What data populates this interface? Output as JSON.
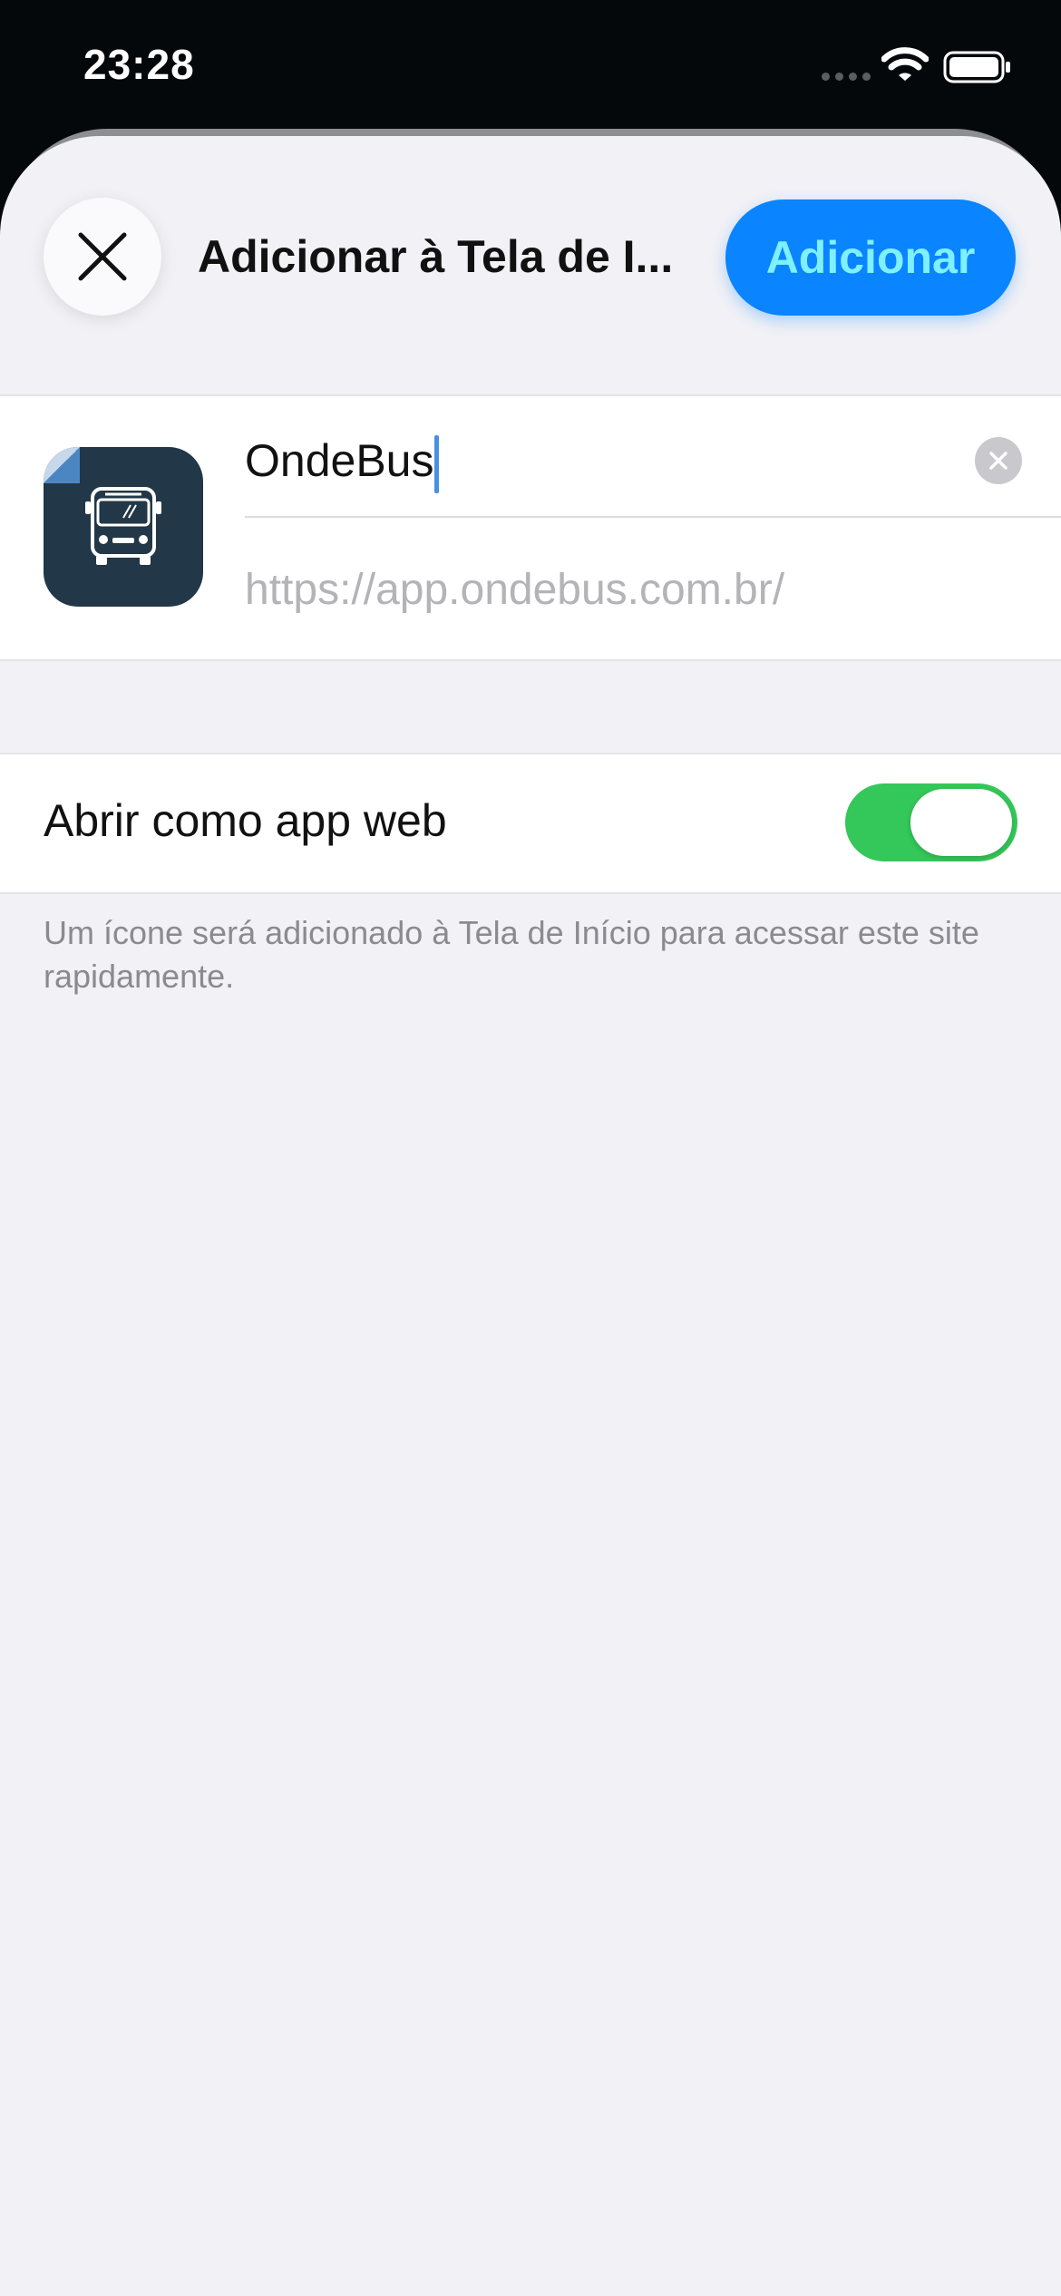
{
  "status_bar": {
    "time": "23:28",
    "icons": [
      "signal-dots-icon",
      "wifi-icon",
      "battery-icon"
    ]
  },
  "header": {
    "close_icon": "close-icon",
    "title": "Adicionar à Tela de I...",
    "add_label": "Adicionar"
  },
  "shortcut": {
    "icon": "bus-icon",
    "name_value": "OndeBus",
    "clear_icon": "clear-icon",
    "url": "https://app.ondebus.com.br/"
  },
  "web_app": {
    "label": "Abrir como app web",
    "enabled": true
  },
  "footer_note": "Um ícone será adicionado à Tela de Início para acessar este site rapidamente.",
  "colors": {
    "accent": "#0a84ff",
    "toggle_on": "#34c759",
    "sheet_background": "#f1f1f6",
    "icon_background": "#223747"
  }
}
